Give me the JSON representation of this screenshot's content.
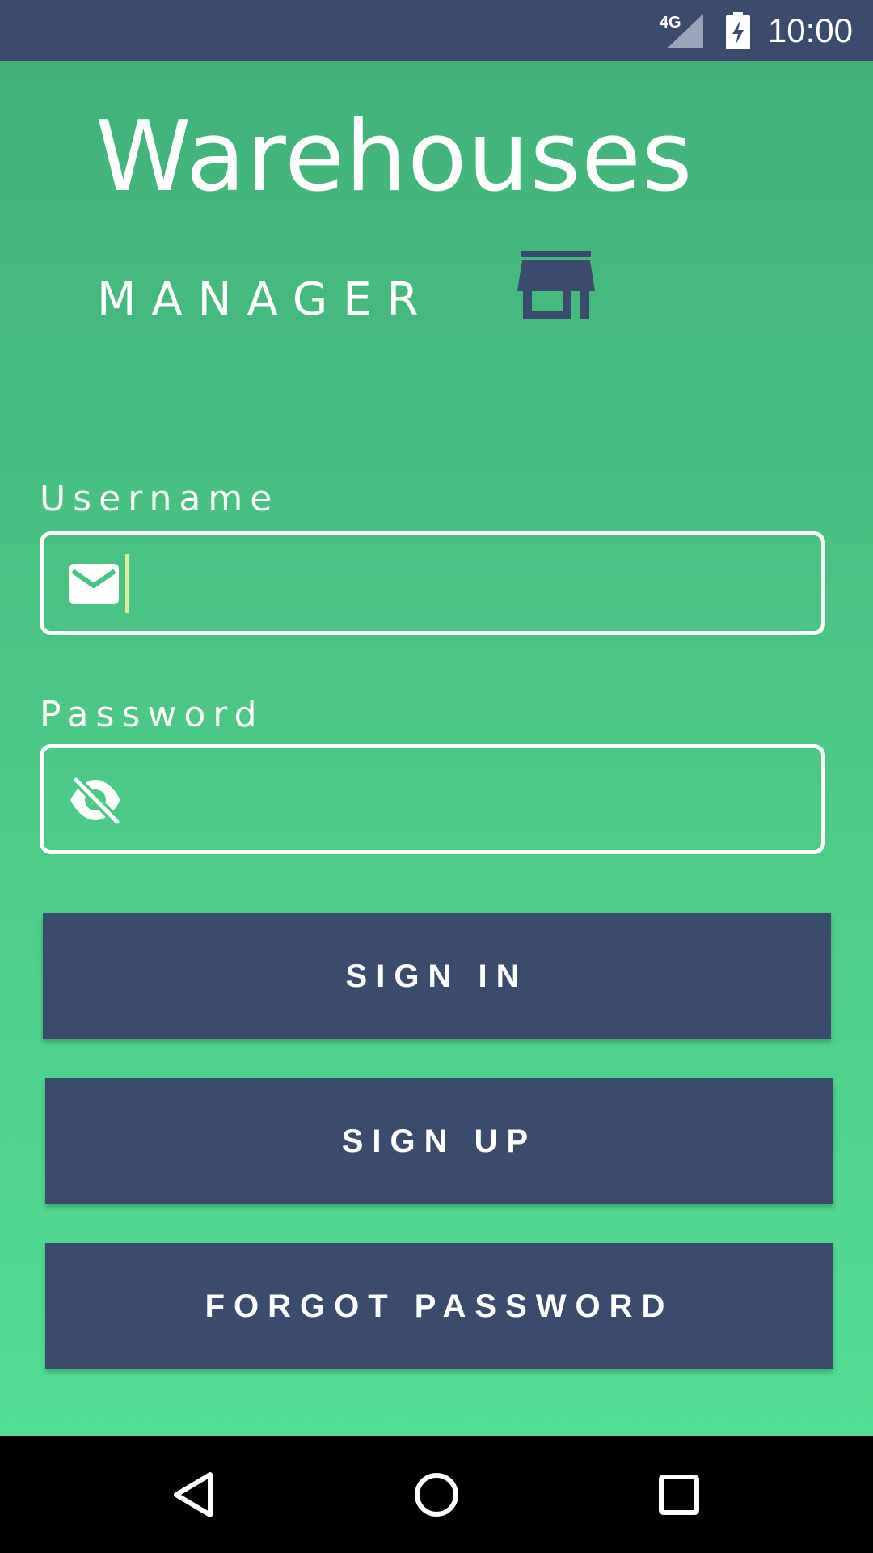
{
  "status_bar": {
    "network": "4G",
    "time": "10:00"
  },
  "app": {
    "title": "Warehouses",
    "subtitle": "MANAGER",
    "brand_icon": "storefront-icon"
  },
  "form": {
    "username_label": "Username",
    "username_value": "",
    "username_icon": "mail-icon",
    "password_label": "Password",
    "password_value": "",
    "password_icon": "eye-off-icon"
  },
  "buttons": {
    "sign_in": "SIGN IN",
    "sign_up": "SIGN UP",
    "forgot_password": "FORGOT PASSWORD"
  },
  "nav": {
    "back_icon": "back-triangle-icon",
    "home_icon": "home-circle-icon",
    "recents_icon": "recents-square-icon"
  },
  "colors": {
    "primary_dark": "#3b4b6e",
    "gradient_top": "#42b27a",
    "gradient_bottom": "#52de94",
    "cursor": "#d8ef9b"
  }
}
